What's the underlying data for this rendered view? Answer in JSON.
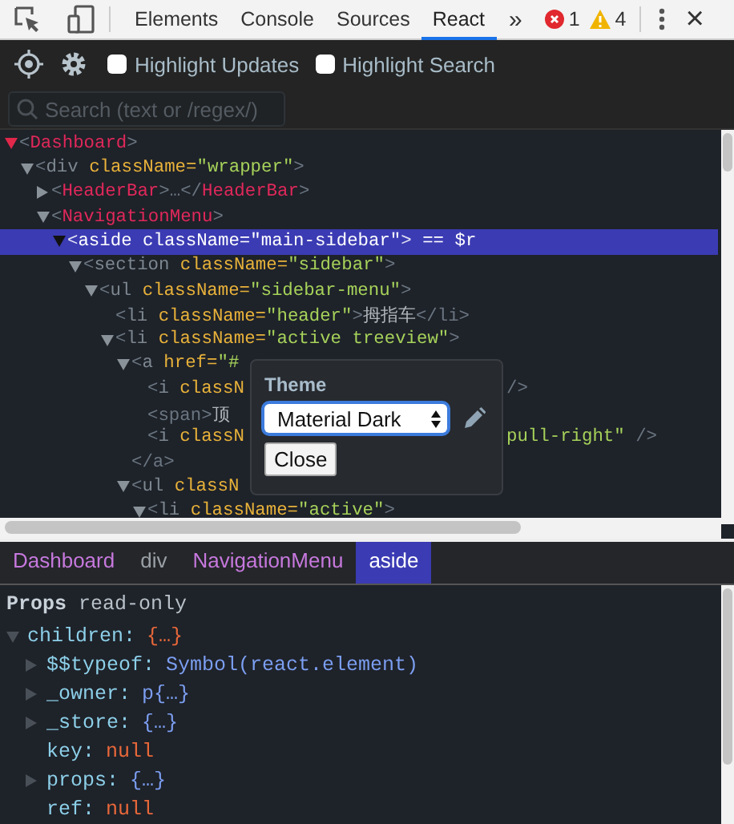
{
  "toolbar": {
    "tabs": [
      {
        "label": "Elements",
        "selected": false
      },
      {
        "label": "Console",
        "selected": false
      },
      {
        "label": "Sources",
        "selected": false
      },
      {
        "label": "React",
        "selected": true
      }
    ],
    "more": "»",
    "errors": "1",
    "warnings": "4",
    "close": "×"
  },
  "filter_bar": {
    "options": [
      {
        "label": "Highlight Updates",
        "checked": false
      },
      {
        "label": "Highlight Search",
        "checked": false
      }
    ],
    "search": {
      "placeholder": "Search (text or /regex/)"
    }
  },
  "tree": [
    {
      "expanded": true,
      "selected": false,
      "parts": [
        {
          "kind": "punct",
          "text": "<"
        },
        {
          "kind": "component",
          "text": "Dashboard"
        },
        {
          "kind": "punct",
          "text": ">"
        }
      ],
      "children": [
        {
          "expanded": true,
          "selected": false,
          "parts": [
            {
              "kind": "punct",
              "text": "<"
            },
            {
              "kind": "dom",
              "text": "div"
            },
            {
              "kind": "attr",
              "text": " className="
            },
            {
              "kind": "value",
              "text": "\"wrapper\""
            },
            {
              "kind": "punct",
              "text": ">"
            }
          ],
          "children": [
            {
              "expanded": false,
              "selected": false,
              "parts": [
                {
                  "kind": "punct",
                  "text": "<"
                },
                {
                  "kind": "component",
                  "text": "HeaderBar"
                },
                {
                  "kind": "punct",
                  "text": ">…</"
                },
                {
                  "kind": "component",
                  "text": "HeaderBar"
                },
                {
                  "kind": "punct",
                  "text": ">"
                }
              ]
            },
            {
              "expanded": true,
              "selected": false,
              "parts": [
                {
                  "kind": "punct",
                  "text": "<"
                },
                {
                  "kind": "component",
                  "text": "NavigationMenu"
                },
                {
                  "kind": "punct",
                  "text": ">"
                }
              ],
              "children": [
                {
                  "expanded": true,
                  "selected": true,
                  "parts": [
                    {
                      "kind": "punct",
                      "text": "<"
                    },
                    {
                      "kind": "dom",
                      "text": "aside"
                    },
                    {
                      "kind": "attr",
                      "text": " className="
                    },
                    {
                      "kind": "value",
                      "text": "\"main-sidebar\""
                    },
                    {
                      "kind": "punct",
                      "text": ">"
                    },
                    {
                      "kind": "ref",
                      "text": " == $r"
                    }
                  ],
                  "children": [
                    {
                      "expanded": true,
                      "selected": false,
                      "parts": [
                        {
                          "kind": "punct",
                          "text": "<"
                        },
                        {
                          "kind": "dom",
                          "text": "section"
                        },
                        {
                          "kind": "attr",
                          "text": " className="
                        },
                        {
                          "kind": "value",
                          "text": "\"sidebar\""
                        },
                        {
                          "kind": "punct",
                          "text": ">"
                        }
                      ],
                      "children": [
                        {
                          "expanded": true,
                          "selected": false,
                          "parts": [
                            {
                              "kind": "punct",
                              "text": "<"
                            },
                            {
                              "kind": "dom",
                              "text": "ul"
                            },
                            {
                              "kind": "attr",
                              "text": " className="
                            },
                            {
                              "kind": "value",
                              "text": "\"sidebar-menu\""
                            },
                            {
                              "kind": "punct",
                              "text": ">"
                            }
                          ],
                          "children": [
                            {
                              "selected": false,
                              "parts": [
                                {
                                  "kind": "punct",
                                  "text": "<"
                                },
                                {
                                  "kind": "dom",
                                  "text": "li"
                                },
                                {
                                  "kind": "attr",
                                  "text": " className="
                                },
                                {
                                  "kind": "value",
                                  "text": "\"header\""
                                },
                                {
                                  "kind": "punct",
                                  "text": ">"
                                },
                                {
                                  "kind": "text",
                                  "text": "拇指车"
                                },
                                {
                                  "kind": "punct",
                                  "text": "</li>"
                                }
                              ]
                            },
                            {
                              "expanded": true,
                              "selected": false,
                              "parts": [
                                {
                                  "kind": "punct",
                                  "text": "<"
                                },
                                {
                                  "kind": "dom",
                                  "text": "li"
                                },
                                {
                                  "kind": "attr",
                                  "text": " className="
                                },
                                {
                                  "kind": "value",
                                  "text": "\"active treeview\""
                                },
                                {
                                  "kind": "punct",
                                  "text": ">"
                                }
                              ],
                              "children": [
                                {
                                  "expanded": true,
                                  "selected": false,
                                  "parts": [
                                    {
                                      "kind": "punct",
                                      "text": "<"
                                    },
                                    {
                                      "kind": "dom",
                                      "text": "a"
                                    },
                                    {
                                      "kind": "attr",
                                      "text": " href="
                                    },
                                    {
                                      "kind": "value",
                                      "text": "\"#"
                                    }
                                  ],
                                  "closing": [
                                    {
                                      "kind": "punct",
                                      "text": "</a>"
                                    }
                                  ],
                                  "children": [
                                    {
                                      "selected": false,
                                      "parts": [
                                        {
                                          "kind": "punct",
                                          "text": "<"
                                        },
                                        {
                                          "kind": "dom",
                                          "text": "i"
                                        },
                                        {
                                          "kind": "attr",
                                          "text": " classN"
                                        }
                                      ],
                                      "tail": [
                                        {
                                          "kind": "punct",
                                          "text": "/>"
                                        }
                                      ]
                                    },
                                    {
                                      "selected": false,
                                      "parts": [
                                        {
                                          "kind": "punct",
                                          "text": "<span>"
                                        },
                                        {
                                          "kind": "text",
                                          "text": "顶"
                                        }
                                      ]
                                    },
                                    {
                                      "selected": false,
                                      "parts": [
                                        {
                                          "kind": "punct",
                                          "text": "<"
                                        },
                                        {
                                          "kind": "dom",
                                          "text": "i"
                                        },
                                        {
                                          "kind": "attr",
                                          "text": " classN"
                                        }
                                      ],
                                      "tail": [
                                        {
                                          "kind": "value",
                                          "text": "pull-right\""
                                        },
                                        {
                                          "kind": "punct",
                                          "text": " />"
                                        }
                                      ]
                                    }
                                  ]
                                },
                                {
                                  "expanded": true,
                                  "selected": false,
                                  "parts": [
                                    {
                                      "kind": "punct",
                                      "text": "<"
                                    },
                                    {
                                      "kind": "dom",
                                      "text": "ul"
                                    },
                                    {
                                      "kind": "attr",
                                      "text": " classN"
                                    }
                                  ],
                                  "children": [
                                    {
                                      "expanded": true,
                                      "selected": false,
                                      "parts": [
                                        {
                                          "kind": "punct",
                                          "text": "<"
                                        },
                                        {
                                          "kind": "dom",
                                          "text": "li"
                                        },
                                        {
                                          "kind": "attr",
                                          "text": " className="
                                        },
                                        {
                                          "kind": "value",
                                          "text": "\"active\""
                                        },
                                        {
                                          "kind": "punct",
                                          "text": ">"
                                        }
                                      ]
                                    }
                                  ]
                                }
                              ]
                            }
                          ]
                        }
                      ]
                    }
                  ]
                }
              ]
            }
          ]
        }
      ]
    }
  ],
  "theme_popup": {
    "title": "Theme",
    "select": {
      "value": "Material Dark"
    },
    "close_button": "Close"
  },
  "breadcrumbs": [
    {
      "label": "Dashboard",
      "kind": "component",
      "selected": false
    },
    {
      "label": "div",
      "kind": "dom",
      "selected": false
    },
    {
      "label": "NavigationMenu",
      "kind": "component",
      "selected": false
    },
    {
      "label": "aside",
      "kind": "dom",
      "selected": true
    }
  ],
  "props": {
    "title": "Props",
    "note": "read-only",
    "items": [
      {
        "key": "children:",
        "value": "{…}",
        "kind": "open",
        "expanded": true,
        "children": [
          {
            "key": "$$typeof:",
            "value": "Symbol(react.element)",
            "kind": "object",
            "expanded": false
          },
          {
            "key": "_owner:",
            "value": "p{…}",
            "kind": "object",
            "expanded": false
          },
          {
            "key": "_store:",
            "value": "{…}",
            "kind": "object",
            "expanded": false
          },
          {
            "key": "key:",
            "value": "null",
            "kind": "null"
          },
          {
            "key": "props:",
            "value": "{…}",
            "kind": "object",
            "expanded": false
          },
          {
            "key": "ref:",
            "value": "null",
            "kind": "null"
          }
        ]
      }
    ]
  }
}
